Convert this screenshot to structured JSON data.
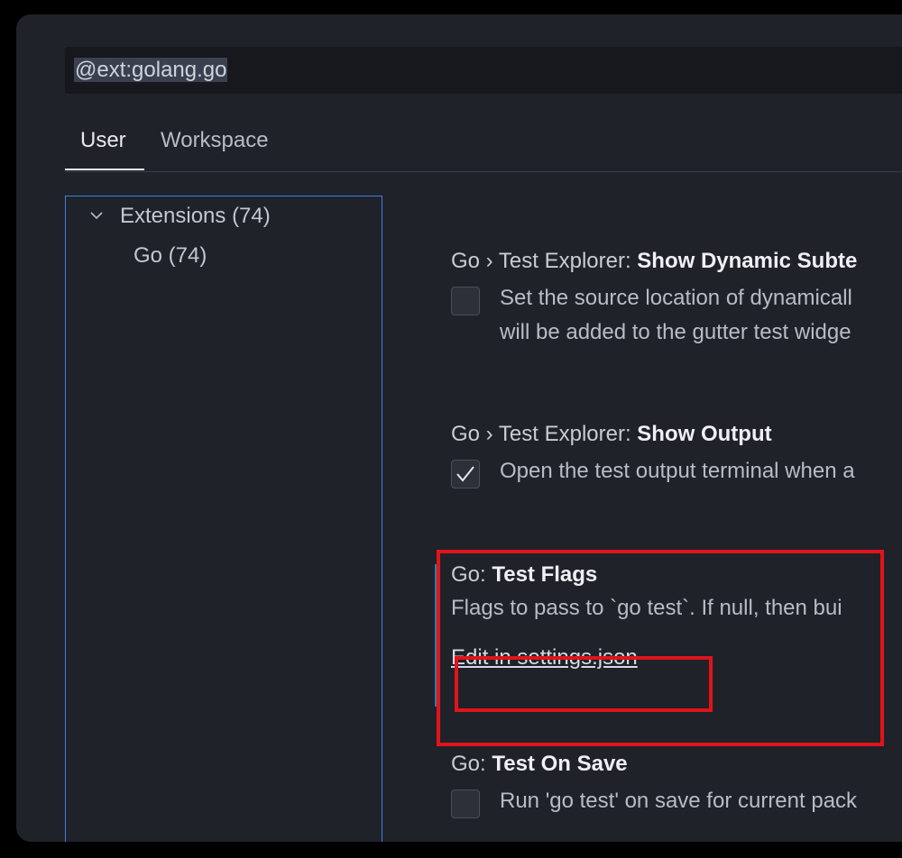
{
  "search": {
    "query": "@ext:golang.go"
  },
  "tabs": [
    {
      "label": "User"
    },
    {
      "label": "Workspace"
    }
  ],
  "tree": {
    "extensions_label": "Extensions (74)",
    "go_label": "Go (74)"
  },
  "settings": [
    {
      "prefix": "Go › Test Explorer: ",
      "name": "Show Dynamic Subte",
      "checked": false,
      "desc_lines": [
        "Set the source location of dynamicall",
        "will be added to the gutter test widge"
      ]
    },
    {
      "prefix": "Go › Test Explorer: ",
      "name": "Show Output",
      "checked": true,
      "desc": "Open the test output terminal when a"
    },
    {
      "prefix": "Go: ",
      "name": "Test Flags",
      "desc": "Flags to pass to `go test`. If null, then bui",
      "link": "Edit in settings.json"
    },
    {
      "prefix": "Go: ",
      "name": "Test On Save",
      "checked": false,
      "desc": "Run 'go test' on save for current pack"
    }
  ],
  "colors": {
    "highlight": "#e0141a",
    "modified_bar": "#2b7cb5",
    "focus_border": "#3d7ee0"
  }
}
